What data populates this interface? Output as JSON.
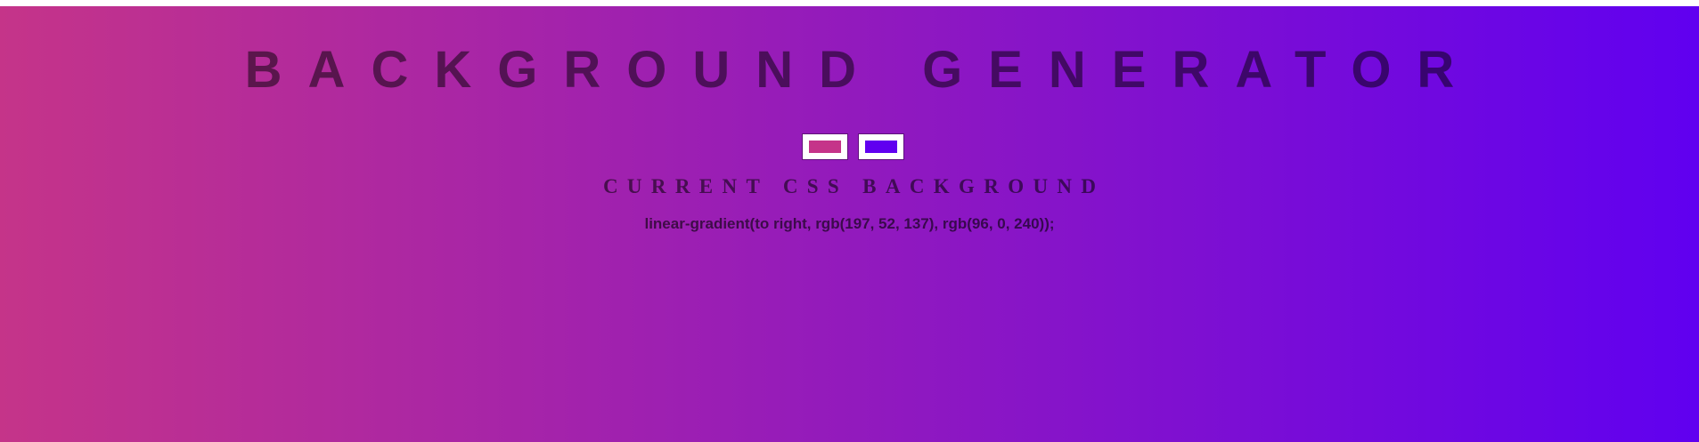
{
  "header": {
    "title": "BACKGROUND GENERATOR"
  },
  "pickers": [
    {
      "value": "#c53489"
    },
    {
      "value": "#6000f0"
    }
  ],
  "output": {
    "heading": "CURRENT CSS BACKGROUND",
    "css_text": "linear-gradient(to right, rgb(197, 52, 137), rgb(96, 0, 240));"
  },
  "colors": {
    "gradient_start": "#c53489",
    "gradient_end": "#6000f0",
    "text": "rgba(0,0,0,0.5)"
  }
}
